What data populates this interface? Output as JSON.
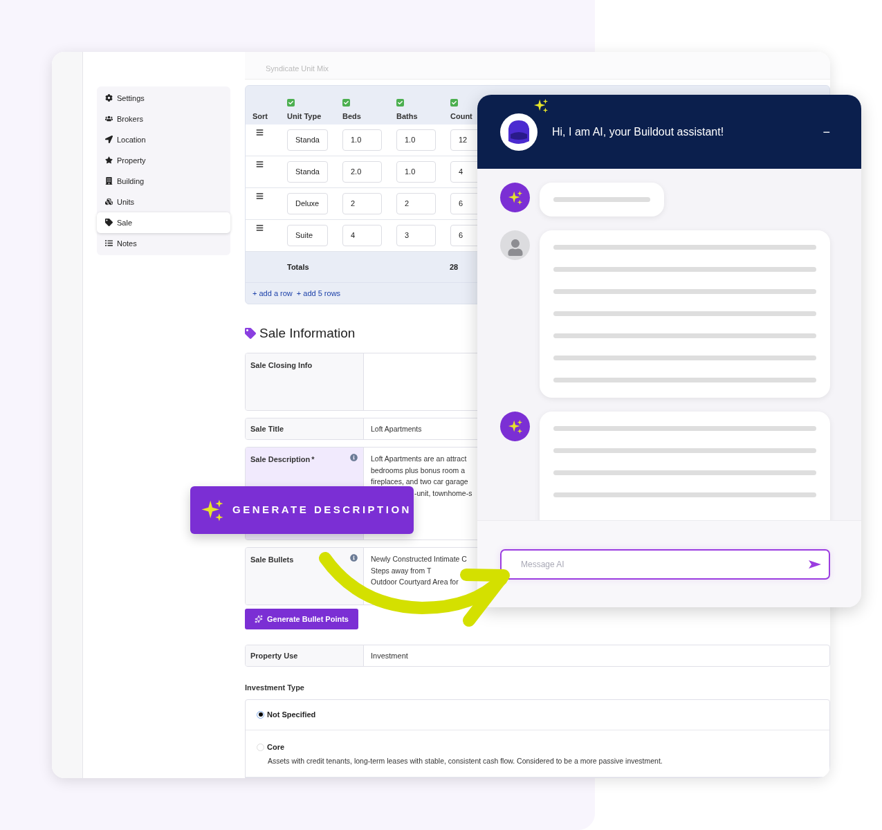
{
  "sidebar": {
    "items": [
      {
        "label": "Settings",
        "selected": false
      },
      {
        "label": "Brokers",
        "selected": false
      },
      {
        "label": "Location",
        "selected": false
      },
      {
        "label": "Property",
        "selected": false
      },
      {
        "label": "Building",
        "selected": false
      },
      {
        "label": "Units",
        "selected": false
      },
      {
        "label": "Sale",
        "selected": true
      },
      {
        "label": "Notes",
        "selected": false
      }
    ]
  },
  "unit_mix": {
    "syndicate_label": "Syndicate Unit Mix",
    "columns": [
      {
        "label": "Sort",
        "kind": "plain"
      },
      {
        "label": "Unit Type",
        "kind": "check",
        "checked": true
      },
      {
        "label": "Beds",
        "kind": "check",
        "checked": true
      },
      {
        "label": "Baths",
        "kind": "check",
        "checked": true
      },
      {
        "label": "Count",
        "kind": "check",
        "checked": true
      }
    ],
    "rows": [
      {
        "cells": [
          "",
          "Standa",
          "1.0",
          "1.0",
          "12"
        ]
      },
      {
        "cells": [
          "",
          "Standa",
          "2.0",
          "1.0",
          "4"
        ]
      },
      {
        "cells": [
          "",
          "Deluxe",
          "2",
          "2",
          "6"
        ]
      },
      {
        "cells": [
          "",
          "Suite",
          "4",
          "3",
          "6"
        ]
      }
    ],
    "totals_label": "Totals",
    "total_count": "28",
    "actions": [
      "+ add a row",
      "+ add 5 rows"
    ]
  },
  "sale": {
    "heading": "Sale Information",
    "fields": [
      {
        "label": "Sale Closing Info",
        "kind": "tall",
        "highlighted": false
      },
      {
        "label": "Sale Title",
        "kind": "short",
        "highlighted": false,
        "lines": [
          "Loft Apartments"
        ]
      },
      {
        "label": "Sale Description",
        "required_mark": "*",
        "kind": "info",
        "highlighted": true,
        "lines": [
          "Loft Apartments are an attract",
          "bedrooms plus bonus room a",
          "fireplaces, and two car garage",
          "-unit, townhome-s"
        ]
      },
      {
        "label": "Sale Bullets",
        "kind": "info",
        "highlighted": false,
        "lines": [
          "Newly Constructed Intimate C",
          "Steps away from T",
          "Outdoor Courtyard Area for"
        ]
      }
    ],
    "bullets_button": "Generate Bullet Points",
    "property_use": {
      "label": "Property Use",
      "value": "Investment"
    },
    "investment_type": {
      "label": "Investment Type",
      "options": [
        {
          "label": "Not Specified",
          "selected": true
        },
        {
          "label": "Core",
          "description": "Assets with credit tenants, long-term leases with stable, consistent cash flow. Considered to be a more passive investment.",
          "selected": false
        }
      ]
    }
  },
  "generate_button": "GENERATE DESCRIPTION",
  "chat": {
    "title": "Hi, I am AI, your Buildout assistant!",
    "minimize": "−",
    "input": {
      "placeholder": "Message AI"
    }
  }
}
